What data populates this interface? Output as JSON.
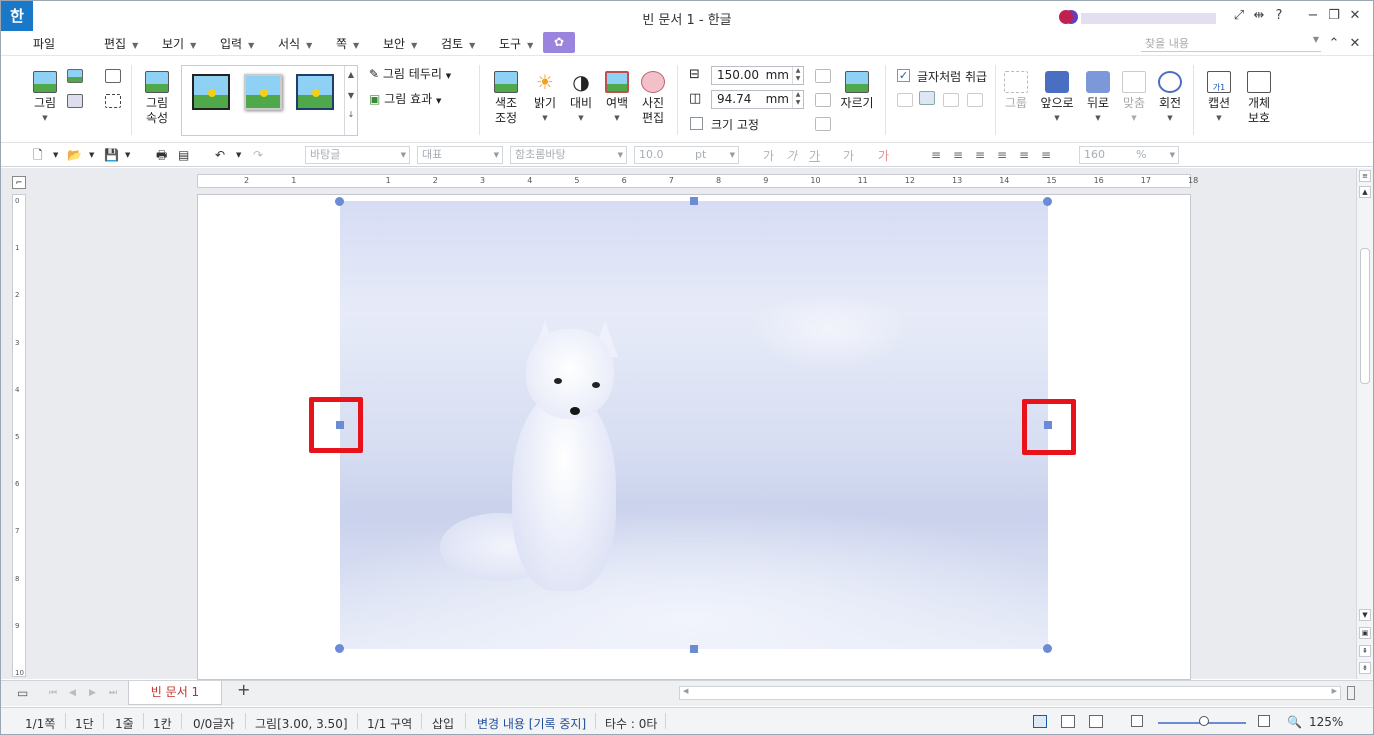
{
  "window": {
    "logo": "한",
    "title": "빈 문서 1 - 한글"
  },
  "menubar": {
    "items": [
      "파일",
      "편집",
      "보기",
      "입력",
      "서식",
      "쪽",
      "보안",
      "검토",
      "도구"
    ],
    "search_placeholder": "찾을 내용"
  },
  "ribbon": {
    "insert_picture": "그림",
    "picture_props": [
      "그림",
      "속성"
    ],
    "picture_border": "그림 테두리",
    "picture_effect": "그림 효과",
    "color_adjust": [
      "색조",
      "조정"
    ],
    "brightness": "밝기",
    "contrast": "대비",
    "margin": "여백",
    "photo_edit": [
      "사진",
      "편집"
    ],
    "width_value": "150.00",
    "height_value": "94.74",
    "unit": "mm",
    "fix_size": "크기 고정",
    "crop": "자르기",
    "treat_as_char": "글자처럼 취급",
    "group": "그룹",
    "bring_front": "앞으로",
    "send_back": "뒤로",
    "align": "맞춤",
    "rotate": "회전",
    "caption": "캡션",
    "caption_icon": "가1",
    "object_protect": [
      "개체",
      "보호"
    ]
  },
  "toolbar2": {
    "style": "바탕글",
    "representative": "대표",
    "font": "함초롬바탕",
    "font_size": "10.0",
    "font_unit": "pt",
    "font_buttons": [
      "가",
      "가",
      "가",
      "가",
      "가"
    ],
    "zoom": "160",
    "zoom_unit": "%"
  },
  "ruler": {
    "h_labels": [
      "2",
      "1",
      "",
      "1",
      "2",
      "3",
      "4",
      "5",
      "6",
      "7",
      "8",
      "9",
      "10",
      "11",
      "12",
      "13",
      "14",
      "15",
      "16",
      "17",
      "18"
    ],
    "v_labels": [
      "0",
      "1",
      "2",
      "3",
      "4",
      "5",
      "6",
      "7",
      "8",
      "9",
      "10"
    ]
  },
  "tabs": {
    "doc_tab": "빈 문서 1",
    "add": "+"
  },
  "status": {
    "page": "1/1쪽",
    "column": "1단",
    "line": "1줄",
    "cell": "1칸",
    "chars": "0/0글자",
    "object": "그림[3.00, 3.50]",
    "section": "1/1 구역",
    "insert": "삽입",
    "track": "변경 내용 [기록 중지]",
    "typing": "타수 : 0타",
    "zoom": "125%"
  },
  "colors": {
    "accent": "#6b8bd4",
    "highlight": "#e8131a",
    "menu_special": "#9a84dd",
    "doc_tab_text": "#c0302a"
  }
}
